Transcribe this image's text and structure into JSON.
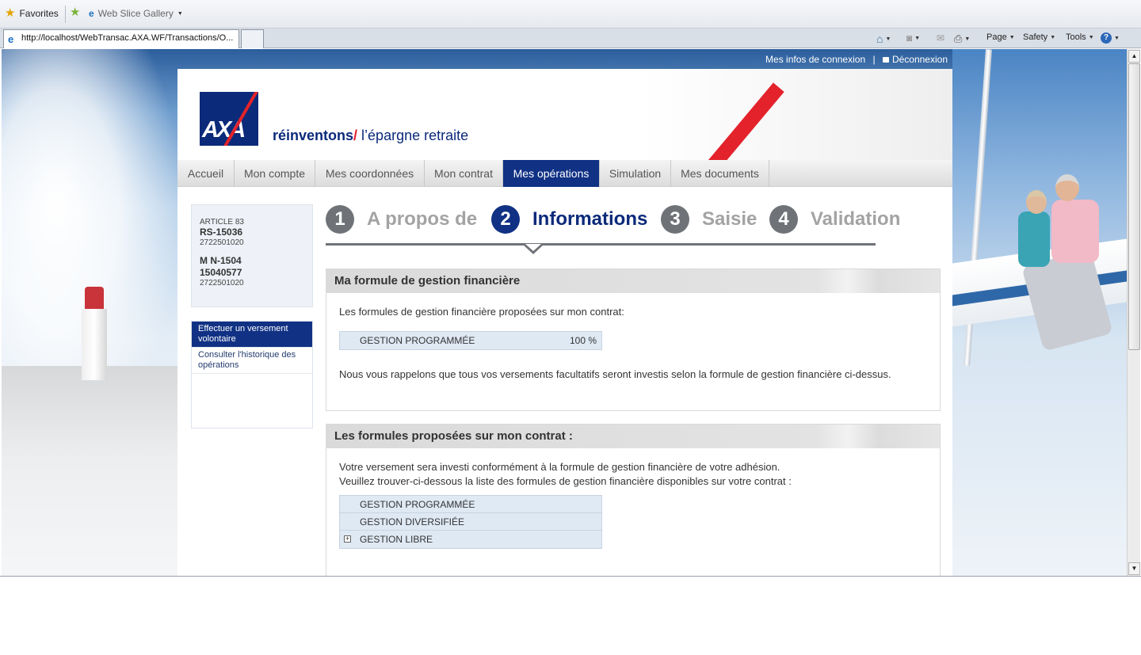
{
  "browser": {
    "favorites_label": "Favorites",
    "web_slice_label": "Web Slice Gallery",
    "tab_url": "http://localhost/WebTransac.AXA.WF/Transactions/O...",
    "cmd_page": "Page",
    "cmd_safety": "Safety",
    "cmd_tools": "Tools"
  },
  "toplinks": {
    "connexion": "Mes infos de connexion",
    "separator": "|",
    "logout": "Déconnexion"
  },
  "brand": {
    "logo_text": "AXA",
    "tagline_bold": "réinventons",
    "tagline_slash": "/",
    "tagline_rest": " l’épargne retraite"
  },
  "nav": [
    "Accueil",
    "Mon compte",
    "Mes coordonnées",
    "Mon contrat",
    "Mes opérations",
    "Simulation",
    "Mes documents"
  ],
  "nav_active": "Mes opérations",
  "sidebar": {
    "contract1_label": "ARTICLE 83",
    "contract1_id": "RS-15036",
    "contract1_num": "2722501020",
    "contract2_line1": "M N-1504",
    "contract2_line2": "15040577",
    "contract2_num": "2722501020",
    "menu": [
      "Effectuer un versement volontaire",
      "Consulter l'historique des opérations"
    ]
  },
  "steps": [
    {
      "num": "1",
      "label": "A propos de"
    },
    {
      "num": "2",
      "label": "Informations"
    },
    {
      "num": "3",
      "label": "Saisie"
    },
    {
      "num": "4",
      "label": "Validation"
    }
  ],
  "panel1": {
    "title": "Ma formule de gestion financière",
    "intro": "Les formules de gestion financière proposées sur mon contrat:",
    "row_label": "GESTION PROGRAMMÉE",
    "row_value": "100 %",
    "note": "Nous vous rappelons que tous vos versements facultatifs seront investis selon la formule de gestion financière ci-dessus."
  },
  "panel2": {
    "title": "Les formules proposées sur mon contrat :",
    "line1": "Votre versement sera investi conformément à la formule de gestion financière de votre adhésion.",
    "line2": "Veuillez trouver-ci-dessous la liste des formules de gestion financière disponibles sur votre contrat :",
    "rows": [
      "GESTION PROGRAMMÉE",
      "GESTION DIVERSIFIÉE",
      "GESTION LIBRE"
    ]
  },
  "colors": {
    "axa_blue": "#103184",
    "axa_red": "#e3222b"
  }
}
